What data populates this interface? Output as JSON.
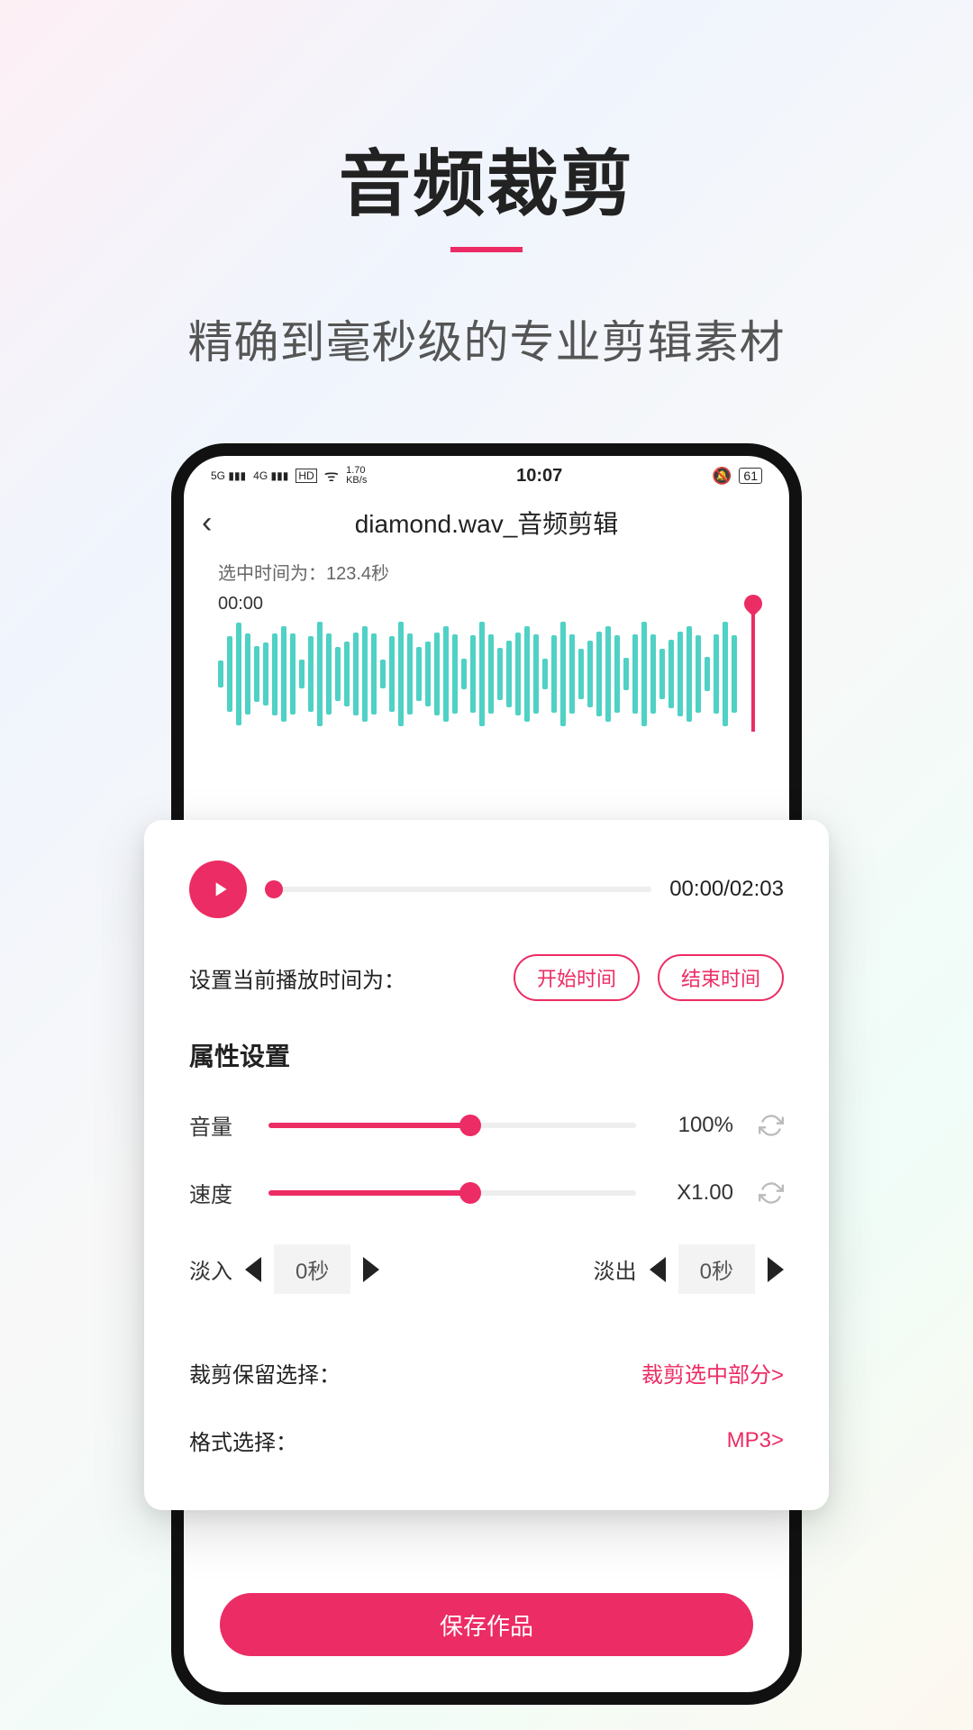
{
  "hero": {
    "title": "音频裁剪",
    "subtitle": "精确到毫秒级的专业剪辑素材"
  },
  "statusbar": {
    "net5g": "5G",
    "net4g": "4G",
    "hd": "HD",
    "speed": "1.70\nKB/s",
    "time": "10:07",
    "battery": "61"
  },
  "header": {
    "title": "diamond.wav_音频剪辑"
  },
  "selection": {
    "label": "选中时间为：",
    "value": "123.4秒",
    "start_label": "00:00"
  },
  "player": {
    "time": "00:00/02:03"
  },
  "set_time": {
    "label": "设置当前播放时间为：",
    "start_btn": "开始时间",
    "end_btn": "结束时间"
  },
  "attrs": {
    "title": "属性设置"
  },
  "volume": {
    "label": "音量",
    "value": "100%",
    "percent": 55
  },
  "speed": {
    "label": "速度",
    "value": "X1.00",
    "percent": 55
  },
  "fade": {
    "in_label": "淡入",
    "in_value": "0秒",
    "out_label": "淡出",
    "out_value": "0秒"
  },
  "crop_keep": {
    "label": "裁剪保留选择：",
    "value": "裁剪选中部分>"
  },
  "format": {
    "label": "格式选择：",
    "value": "MP3>"
  },
  "save": {
    "label": "保存作品"
  }
}
